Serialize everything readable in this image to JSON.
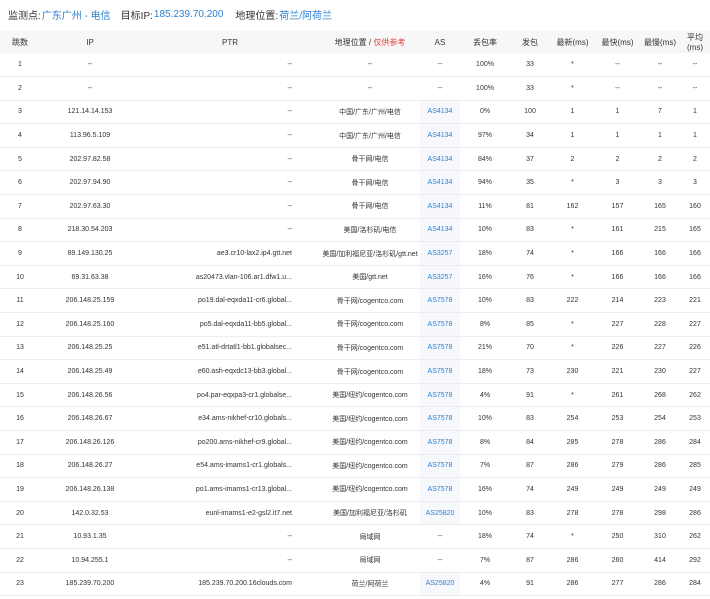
{
  "header": {
    "monitor_label": "监测点:",
    "monitor_value": "广东广州 - 电信",
    "target_label": "目标IP:",
    "target_value": "185.239.70.200",
    "location_label": "地理位置:",
    "location_value": "荷兰/阿荷兰"
  },
  "columns": {
    "hop": "跳数",
    "ip": "IP",
    "ptr": "PTR",
    "geo": "地理位置 / ",
    "geo_ref": "仅供参考",
    "as": "AS",
    "loss": "丢包率",
    "sent": "发包",
    "last": "最新(ms)",
    "best": "最快(ms)",
    "worst": "最慢(ms)",
    "avg": "平均(ms)"
  },
  "rows": [
    {
      "hop": "1",
      "ip": "--",
      "ptr": "--",
      "geo": "--",
      "as": "--",
      "loss": "100%",
      "sent": "33",
      "last": "*",
      "best": "--",
      "worst": "--",
      "avg": "--"
    },
    {
      "hop": "2",
      "ip": "--",
      "ptr": "--",
      "geo": "--",
      "as": "--",
      "loss": "100%",
      "sent": "33",
      "last": "*",
      "best": "--",
      "worst": "--",
      "avg": "--"
    },
    {
      "hop": "3",
      "ip": "121.14.14.153",
      "ptr": "--",
      "geo": "中国/广东/广州/电信",
      "as": "AS4134",
      "loss": "0%",
      "sent": "100",
      "last": "1",
      "best": "1",
      "worst": "7",
      "avg": "1"
    },
    {
      "hop": "4",
      "ip": "113.96.5.109",
      "ptr": "--",
      "geo": "中国/广东/广州/电信",
      "as": "AS4134",
      "loss": "97%",
      "sent": "34",
      "last": "1",
      "best": "1",
      "worst": "1",
      "avg": "1"
    },
    {
      "hop": "5",
      "ip": "202.97.82.58",
      "ptr": "--",
      "geo": "骨干网/电信",
      "as": "AS4134",
      "loss": "84%",
      "sent": "37",
      "last": "2",
      "best": "2",
      "worst": "2",
      "avg": "2"
    },
    {
      "hop": "6",
      "ip": "202.97.94.90",
      "ptr": "--",
      "geo": "骨干网/电信",
      "as": "AS4134",
      "loss": "94%",
      "sent": "35",
      "last": "*",
      "best": "3",
      "worst": "3",
      "avg": "3"
    },
    {
      "hop": "7",
      "ip": "202.97.63.30",
      "ptr": "--",
      "geo": "骨干网/电信",
      "as": "AS4134",
      "loss": "11%",
      "sent": "81",
      "last": "162",
      "best": "157",
      "worst": "165",
      "avg": "160"
    },
    {
      "hop": "8",
      "ip": "218.30.54.203",
      "ptr": "--",
      "geo": "美国/洛杉矶/电信",
      "as": "AS4134",
      "loss": "10%",
      "sent": "83",
      "last": "*",
      "best": "161",
      "worst": "215",
      "avg": "165"
    },
    {
      "hop": "9",
      "ip": "89.149.130.25",
      "ptr": "ae3.cr10-lax2.ip4.gtt.net",
      "geo": "美国/加利福尼亚/洛杉矶/gtt.net",
      "as": "AS3257",
      "loss": "18%",
      "sent": "74",
      "last": "*",
      "best": "166",
      "worst": "166",
      "avg": "166"
    },
    {
      "hop": "10",
      "ip": "69.31.63.38",
      "ptr": "as20473.vlan-106.ar1.dfw1.u...",
      "geo": "美国/gtt.net",
      "as": "AS3257",
      "loss": "16%",
      "sent": "76",
      "last": "*",
      "best": "166",
      "worst": "166",
      "avg": "166"
    },
    {
      "hop": "11",
      "ip": "206.148.25.159",
      "ptr": "po19.dal-eqxda11-cr6.global...",
      "geo": "骨干网/cogentco.com",
      "as": "AS7578",
      "loss": "10%",
      "sent": "83",
      "last": "222",
      "best": "214",
      "worst": "223",
      "avg": "221"
    },
    {
      "hop": "12",
      "ip": "206.148.25.160",
      "ptr": "po5.dal-eqxda11-bb5.global...",
      "geo": "骨干网/cogentco.com",
      "as": "AS7578",
      "loss": "8%",
      "sent": "85",
      "last": "*",
      "best": "227",
      "worst": "228",
      "avg": "227"
    },
    {
      "hop": "13",
      "ip": "206.148.25.25",
      "ptr": "e51.atl-drtatl1-bb1.globalsec...",
      "geo": "骨干网/cogentco.com",
      "as": "AS7578",
      "loss": "21%",
      "sent": "70",
      "last": "*",
      "best": "226",
      "worst": "227",
      "avg": "226"
    },
    {
      "hop": "14",
      "ip": "206.148.25.49",
      "ptr": "e60.ash-eqxdc13-bb3.global...",
      "geo": "骨干网/cogentco.com",
      "as": "AS7578",
      "loss": "18%",
      "sent": "73",
      "last": "230",
      "best": "221",
      "worst": "230",
      "avg": "227"
    },
    {
      "hop": "15",
      "ip": "206.148.26.56",
      "ptr": "po4.par-eqxpa3-cr1.globalse...",
      "geo": "美国/纽约/cogentco.com",
      "as": "AS7578",
      "loss": "4%",
      "sent": "91",
      "last": "*",
      "best": "261",
      "worst": "268",
      "avg": "262"
    },
    {
      "hop": "16",
      "ip": "206.148.26.67",
      "ptr": "e34.ams-nikhef-cr10.globals...",
      "geo": "美国/纽约/cogentco.com",
      "as": "AS7578",
      "loss": "10%",
      "sent": "83",
      "last": "254",
      "best": "253",
      "worst": "254",
      "avg": "253"
    },
    {
      "hop": "17",
      "ip": "206.148.26.126",
      "ptr": "po200.ams-nikhef-cr9.global...",
      "geo": "美国/纽约/cogentco.com",
      "as": "AS7578",
      "loss": "8%",
      "sent": "84",
      "last": "285",
      "best": "278",
      "worst": "286",
      "avg": "284"
    },
    {
      "hop": "18",
      "ip": "206.148.26.27",
      "ptr": "e54.ams-imams1-cr1.globals...",
      "geo": "美国/纽约/cogentco.com",
      "as": "AS7578",
      "loss": "7%",
      "sent": "87",
      "last": "286",
      "best": "279",
      "worst": "286",
      "avg": "285"
    },
    {
      "hop": "19",
      "ip": "206.148.26.138",
      "ptr": "po1.ams-imams1-cr13.global...",
      "geo": "美国/纽约/cogentco.com",
      "as": "AS7578",
      "loss": "16%",
      "sent": "74",
      "last": "249",
      "best": "249",
      "worst": "249",
      "avg": "249"
    },
    {
      "hop": "20",
      "ip": "142.0.32.53",
      "ptr": "eunl-imams1-e2-gsl2.it7.net",
      "geo": "美国/加利福尼亚/洛杉矶",
      "as": "AS25820",
      "loss": "10%",
      "sent": "83",
      "last": "278",
      "best": "278",
      "worst": "298",
      "avg": "286"
    },
    {
      "hop": "21",
      "ip": "10.93.1.35",
      "ptr": "--",
      "geo": "局域网",
      "as": "--",
      "loss": "18%",
      "sent": "74",
      "last": "*",
      "best": "250",
      "worst": "310",
      "avg": "262"
    },
    {
      "hop": "22",
      "ip": "10.94.255.1",
      "ptr": "--",
      "geo": "局域网",
      "as": "--",
      "loss": "7%",
      "sent": "87",
      "last": "286",
      "best": "260",
      "worst": "414",
      "avg": "292"
    },
    {
      "hop": "23",
      "ip": "185.239.70.200",
      "ptr": "185.239.70.200.16clouds.com",
      "geo": "荷兰/阿荷兰",
      "as": "AS25820",
      "loss": "4%",
      "sent": "91",
      "last": "286",
      "best": "277",
      "worst": "286",
      "avg": "284"
    }
  ]
}
